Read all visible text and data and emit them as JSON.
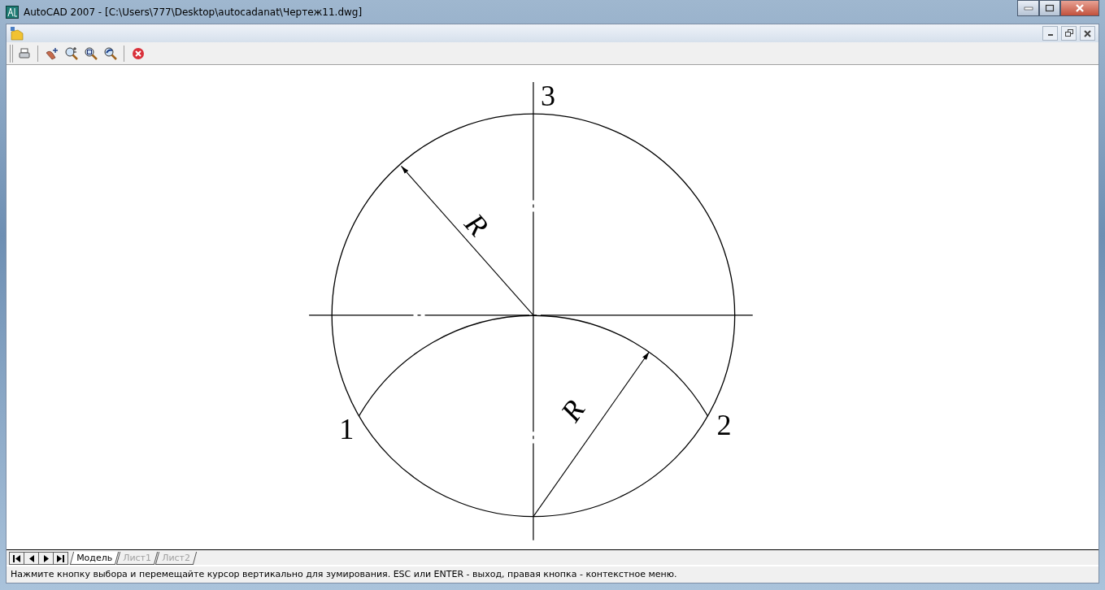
{
  "window": {
    "title": "AutoCAD 2007 - [C:\\Users\\777\\Desktop\\autocadanat\\Чертеж11.dwg]"
  },
  "drawing": {
    "point_labels": [
      "1",
      "2",
      "3"
    ],
    "radius_labels": [
      "R",
      "R"
    ]
  },
  "layout_tabs": [
    {
      "label": "Модель",
      "selected": true
    },
    {
      "label": "Лист1",
      "selected": false
    },
    {
      "label": "Лист2",
      "selected": false
    }
  ],
  "status_bar": "Нажмите кнопку выбора и перемещайте курсор вертикально для зумирования. ESC или ENTER - выход, правая кнопка - контекстное меню."
}
